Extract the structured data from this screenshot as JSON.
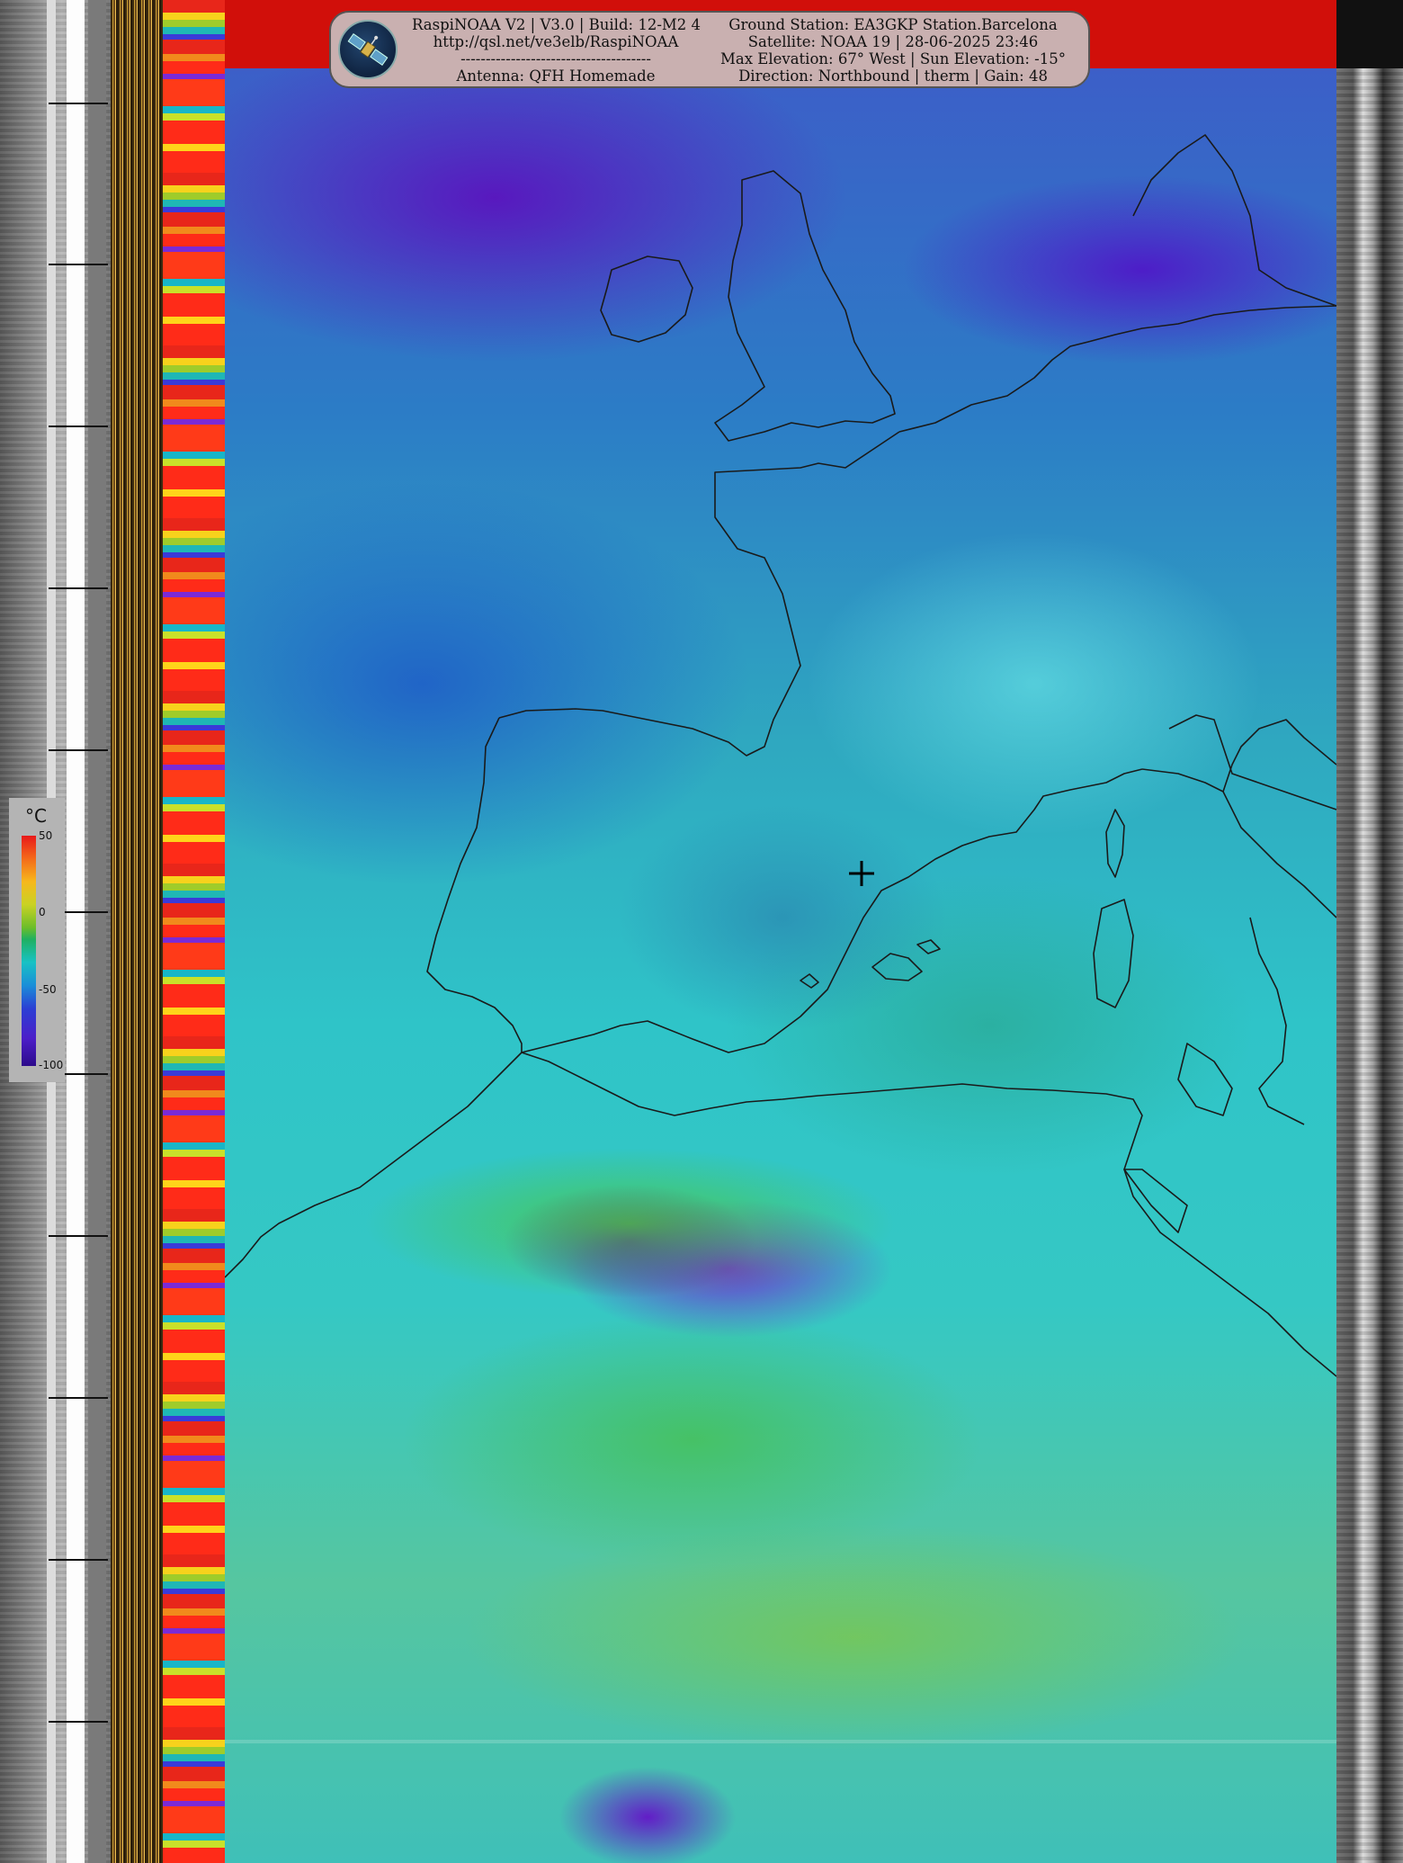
{
  "header": {
    "left_lines": [
      "RaspiNOAA V2 | V3.0 | Build: 12-M2 4",
      "http://qsl.net/ve3elb/RaspiNOAA",
      "--------------------------------------",
      "Antenna: QFH Homemade"
    ],
    "right_lines": [
      "Ground Station: EA3GKP Station.Barcelona",
      "Satellite: NOAA 19 | 28-06-2025 23:46",
      "Max Elevation: 67° West | Sun Elevation: -15°",
      "Direction: Northbound | therm | Gain: 48"
    ],
    "logo_icon": "satellite-logo-icon"
  },
  "legend": {
    "unit": "°C",
    "ticks": [
      "50",
      "0",
      "-50",
      "-100"
    ],
    "colors": [
      "#e8191a",
      "#f6b81c",
      "#6bbd2a",
      "#18c2c4",
      "#2b3fd4",
      "#2d0a8a"
    ]
  },
  "map": {
    "marker_icon": "crosshair-icon",
    "coastline_color": "#1a1a1a"
  }
}
